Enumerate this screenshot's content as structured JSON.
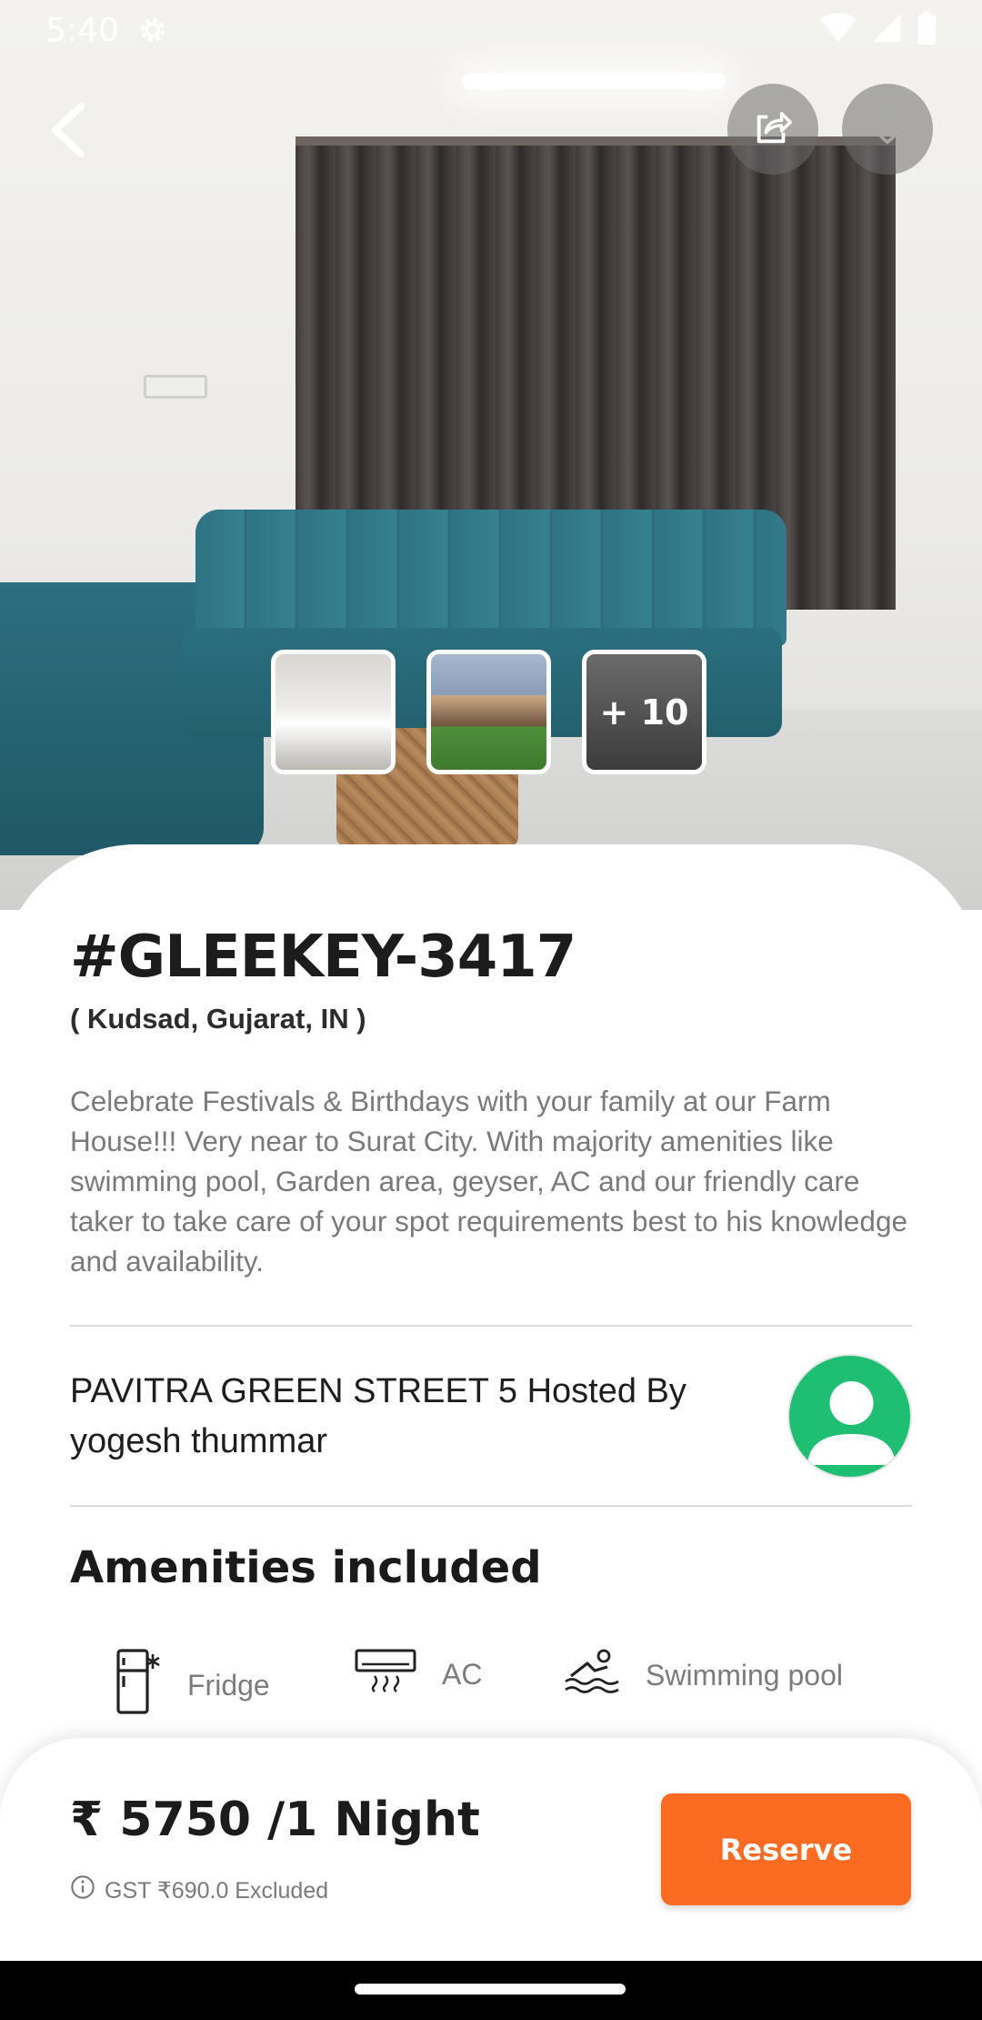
{
  "status_bar": {
    "time": "5:40"
  },
  "gallery": {
    "more_label": "+ 10"
  },
  "listing": {
    "title": "#GLEEKEY-3417",
    "location": "( Kudsad, Gujarat, IN )",
    "description": "Celebrate Festivals & Birthdays with your family at our Farm House!!! Very near to Surat City. With majority amenities like swimming pool, Garden area, geyser, AC and our friendly care taker to take care of your spot requirements best to his knowledge and availability."
  },
  "host": {
    "text": "PAVITRA GREEN STREET 5 Hosted By yogesh thummar"
  },
  "amenities": {
    "title": "Amenities included",
    "items": [
      {
        "label": "Fridge",
        "icon": "fridge-icon"
      },
      {
        "label": "AC",
        "icon": "ac-icon"
      },
      {
        "label": "Swimming pool",
        "icon": "swimming-pool-icon"
      }
    ]
  },
  "booking": {
    "price": "₹ 5750 /1 Night",
    "gst": "GST ₹690.0 Excluded",
    "reserve_label": "Reserve",
    "accent_color": "#fb6b22"
  },
  "colors": {
    "host_avatar": "#1fbf73"
  }
}
